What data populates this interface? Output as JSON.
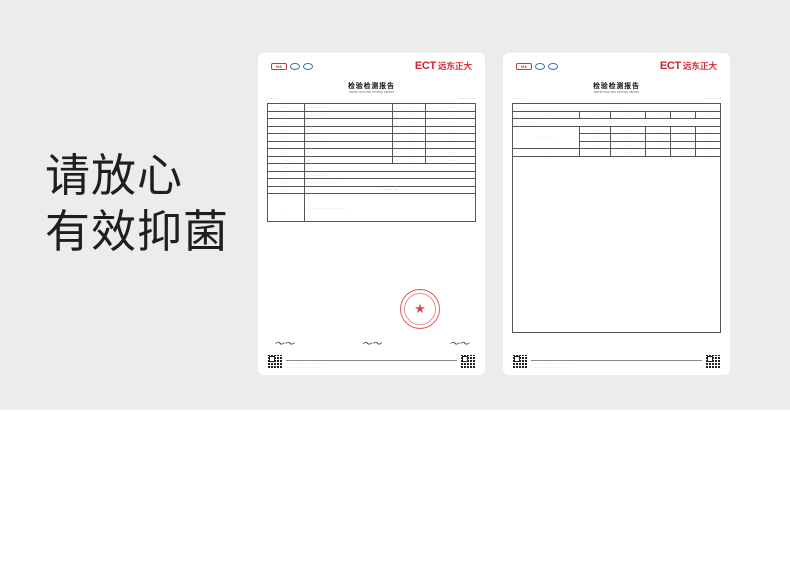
{
  "headline": {
    "line1": "请放心",
    "line2": "有效抑菌"
  },
  "report": {
    "brand_en": "ECT",
    "brand_zh": "远东正大",
    "title": "检验检测报告",
    "subtitle": "INSPECTION AND TESTING REPORT",
    "cert_logos": [
      "MA",
      "CNAS",
      "CNAS"
    ]
  },
  "colors": {
    "band": "#ececec",
    "brand_red": "#d4212b",
    "headline": "#1e1e1e"
  },
  "icons": [
    "cma-logo",
    "cnas-logo",
    "qr-code-icon",
    "official-seal-icon"
  ]
}
